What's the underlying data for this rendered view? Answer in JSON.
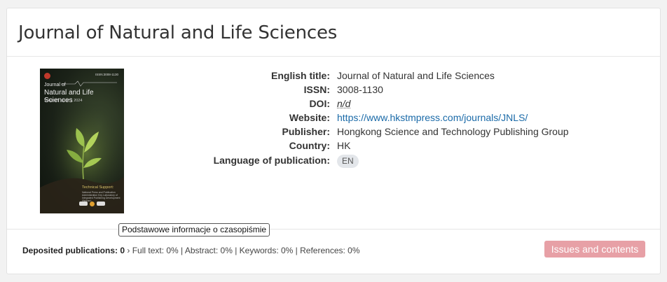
{
  "journal": {
    "title": "Journal of Natural and Life Sciences"
  },
  "cover": {
    "issn": "ISSN:3008-1130",
    "line1": "Journal of",
    "line2": "Natural and Life Sciences",
    "line3": "Volume1 Issue 1 2024",
    "tech": "Technical Support:",
    "tech_detail": "National Press and Publication Administration Key Laboratory of Integrated Publishing Development (Wuhan)"
  },
  "tooltip": "Podstawowe informacje o czasopiśmie",
  "details": {
    "english_title_label": "English title:",
    "english_title": "Journal of Natural and Life Sciences",
    "issn_label": "ISSN:",
    "issn": "3008-1130",
    "doi_label": "DOI:",
    "doi": "n/d",
    "website_label": "Website:",
    "website": "https://www.hkstmpress.com/journals/JNLS/",
    "publisher_label": "Publisher:",
    "publisher": "Hongkong Science and Technology Publishing Group",
    "country_label": "Country:",
    "country": "HK",
    "language_label": "Language of publication:",
    "language": "EN"
  },
  "footer": {
    "deposited_label": "Deposited publications: 0",
    "stats": "› Full text: 0% | Abstract: 0% | Keywords: 0% | References: 0%"
  },
  "actions": {
    "issues_button": "Issues and contents"
  },
  "colors": {
    "link": "#1a6aa8",
    "button": "#e7a0a6"
  }
}
